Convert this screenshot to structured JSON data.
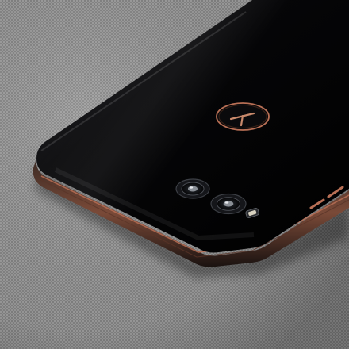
{
  "photo": {
    "subject": "smartphone-rear",
    "colors": {
      "fabric": "#8f8f8f",
      "phone_body": "#050507",
      "accent_rose_gold": "#b86f55",
      "frame_edge": "#2a1e1a"
    },
    "logo_text": "T"
  }
}
